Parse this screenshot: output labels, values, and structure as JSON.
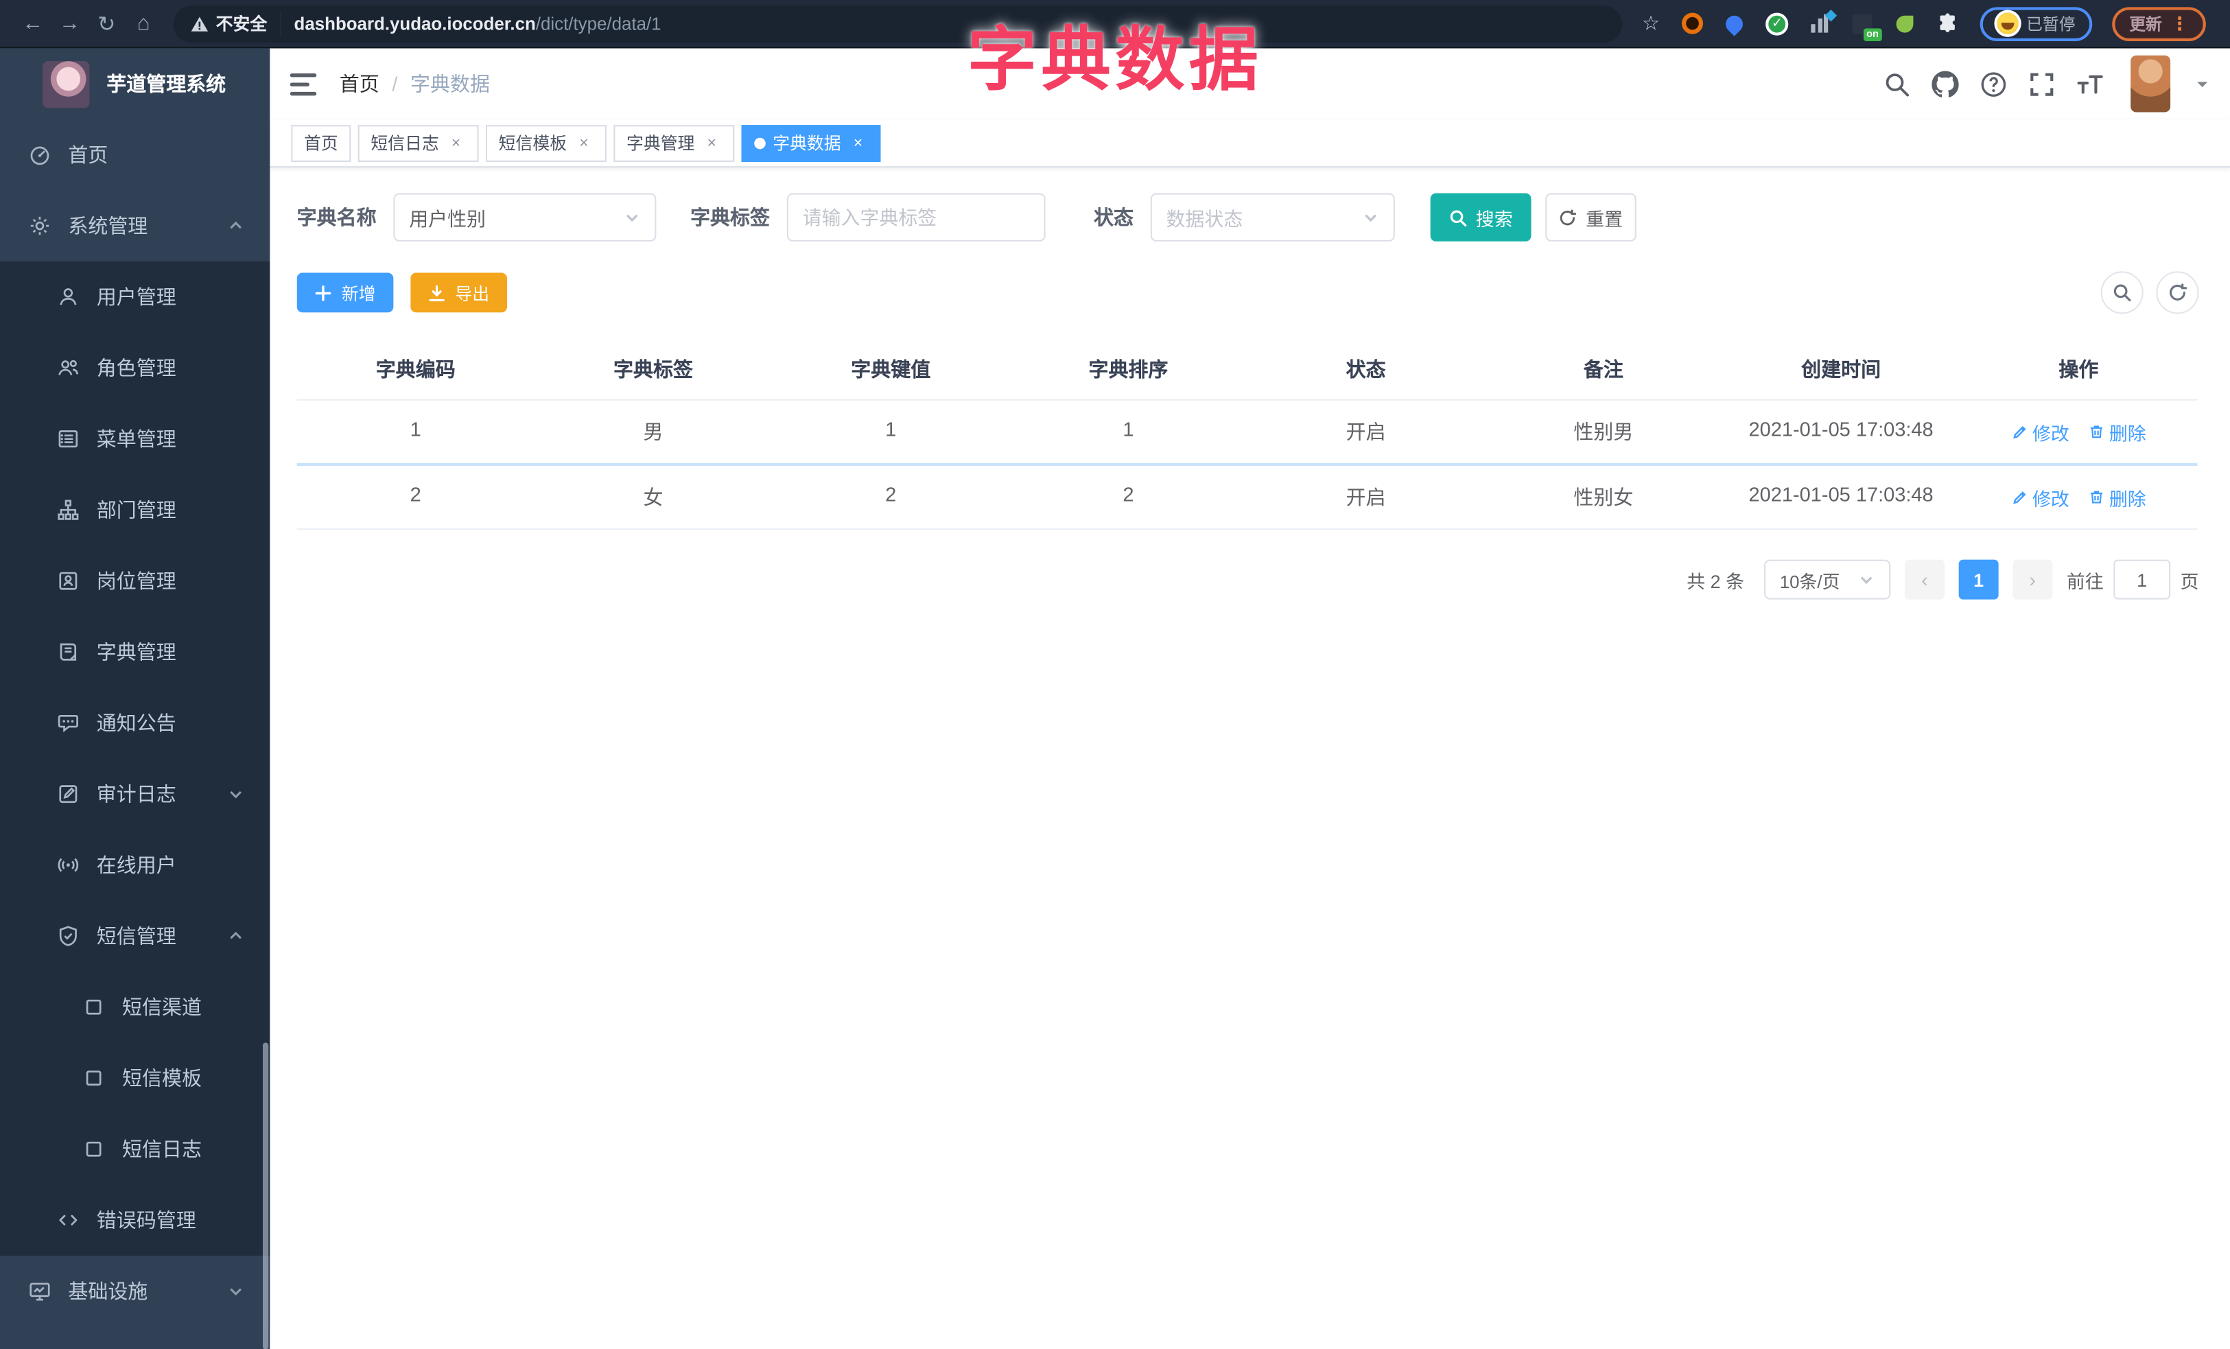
{
  "overlay": {
    "title": "字典数据",
    "color": "#f43f63"
  },
  "browser": {
    "security_label": "不安全",
    "url_host": "dashboard.yudao.iocoder.cn",
    "url_path": "/dict/type/data/1",
    "paused_badge_label": "已暂停",
    "update_button_label": "更新",
    "extension_on_badge": "on"
  },
  "icons_legend": {
    "back-icon": "←",
    "forward-icon": "→",
    "reload-icon": "↻",
    "home-icon": "⌂",
    "bookmark-star-icon": "☆",
    "warning-triangle-icon": "⚠",
    "caret-down-icon": "▾",
    "browser-menu-icon": "⋮",
    "close-icon": "×",
    "prev-page-icon": "‹",
    "next-page-icon": "›"
  },
  "sidebar": {
    "logo_title": "芋道管理系统",
    "menu": [
      {
        "key": "home",
        "label": "首页",
        "icon": "dashboard",
        "level": 0
      },
      {
        "key": "system",
        "label": "系统管理",
        "icon": "gear",
        "level": 0,
        "expand": "up"
      },
      {
        "key": "user-mgmt",
        "label": "用户管理",
        "icon": "user",
        "level": 1
      },
      {
        "key": "role-mgmt",
        "label": "角色管理",
        "icon": "users",
        "level": 1
      },
      {
        "key": "menu-mgmt",
        "label": "菜单管理",
        "icon": "list",
        "level": 1
      },
      {
        "key": "dept-mgmt",
        "label": "部门管理",
        "icon": "tree",
        "level": 1
      },
      {
        "key": "post-mgmt",
        "label": "岗位管理",
        "icon": "badge",
        "level": 1
      },
      {
        "key": "dict-mgmt",
        "label": "字典管理",
        "icon": "book",
        "level": 1
      },
      {
        "key": "notice",
        "label": "通知公告",
        "icon": "chat",
        "level": 1
      },
      {
        "key": "audit-log",
        "label": "审计日志",
        "icon": "editnote",
        "level": 1,
        "expand": "down"
      },
      {
        "key": "online-user",
        "label": "在线用户",
        "icon": "online",
        "level": 1
      },
      {
        "key": "sms-mgmt",
        "label": "短信管理",
        "icon": "shield",
        "level": 1,
        "expand": "up"
      },
      {
        "key": "sms-channel",
        "label": "短信渠道",
        "icon": "square",
        "level": 2
      },
      {
        "key": "sms-template",
        "label": "短信模板",
        "icon": "square",
        "level": 2
      },
      {
        "key": "sms-log",
        "label": "短信日志",
        "icon": "square",
        "level": 2
      },
      {
        "key": "error-code",
        "label": "错误码管理",
        "icon": "code",
        "level": 1
      },
      {
        "key": "infra",
        "label": "基础设施",
        "icon": "monitor",
        "level": 0,
        "expand": "down"
      }
    ]
  },
  "header": {
    "breadcrumb_home": "首页",
    "breadcrumb_separator": "/",
    "breadcrumb_current": "字典数据"
  },
  "tabs": [
    {
      "key": "home",
      "label": "首页",
      "closable": false,
      "active": false
    },
    {
      "key": "sms-log",
      "label": "短信日志",
      "closable": true,
      "active": false
    },
    {
      "key": "sms-template",
      "label": "短信模板",
      "closable": true,
      "active": false
    },
    {
      "key": "dict-type",
      "label": "字典管理",
      "closable": true,
      "active": false
    },
    {
      "key": "dict-data",
      "label": "字典数据",
      "closable": true,
      "active": true
    }
  ],
  "filters": {
    "name_label": "字典名称",
    "name_value": "用户性别",
    "tag_label": "字典标签",
    "tag_placeholder": "请输入字典标签",
    "status_label": "状态",
    "status_placeholder": "数据状态",
    "search_label": "搜索",
    "reset_label": "重置"
  },
  "toolbar": {
    "add_label": "新增",
    "export_label": "导出"
  },
  "table": {
    "columns": [
      "字典编码",
      "字典标签",
      "字典键值",
      "字典排序",
      "状态",
      "备注",
      "创建时间",
      "操作"
    ],
    "rows": [
      [
        "1",
        "男",
        "1",
        "1",
        "开启",
        "性别男",
        "2021-01-05 17:03:48"
      ],
      [
        "2",
        "女",
        "2",
        "2",
        "开启",
        "性别女",
        "2021-01-05 17:03:48"
      ]
    ],
    "edit_label": "修改",
    "delete_label": "删除"
  },
  "pagination": {
    "total_text": "共 2 条",
    "page_size_value": "10条/页",
    "current_page": "1",
    "goto_label": "前往",
    "goto_value": "1",
    "page_unit_label": "页"
  },
  "colors": {
    "accent_blue": "#409EFF",
    "search_teal": "#18b3a8",
    "export_orange": "#f3a51c",
    "sidebar_bg": "#304156",
    "submenu_bg": "#1f2d3d",
    "overlay_pink": "#f43f63",
    "browser_bar": "#212b3b"
  }
}
